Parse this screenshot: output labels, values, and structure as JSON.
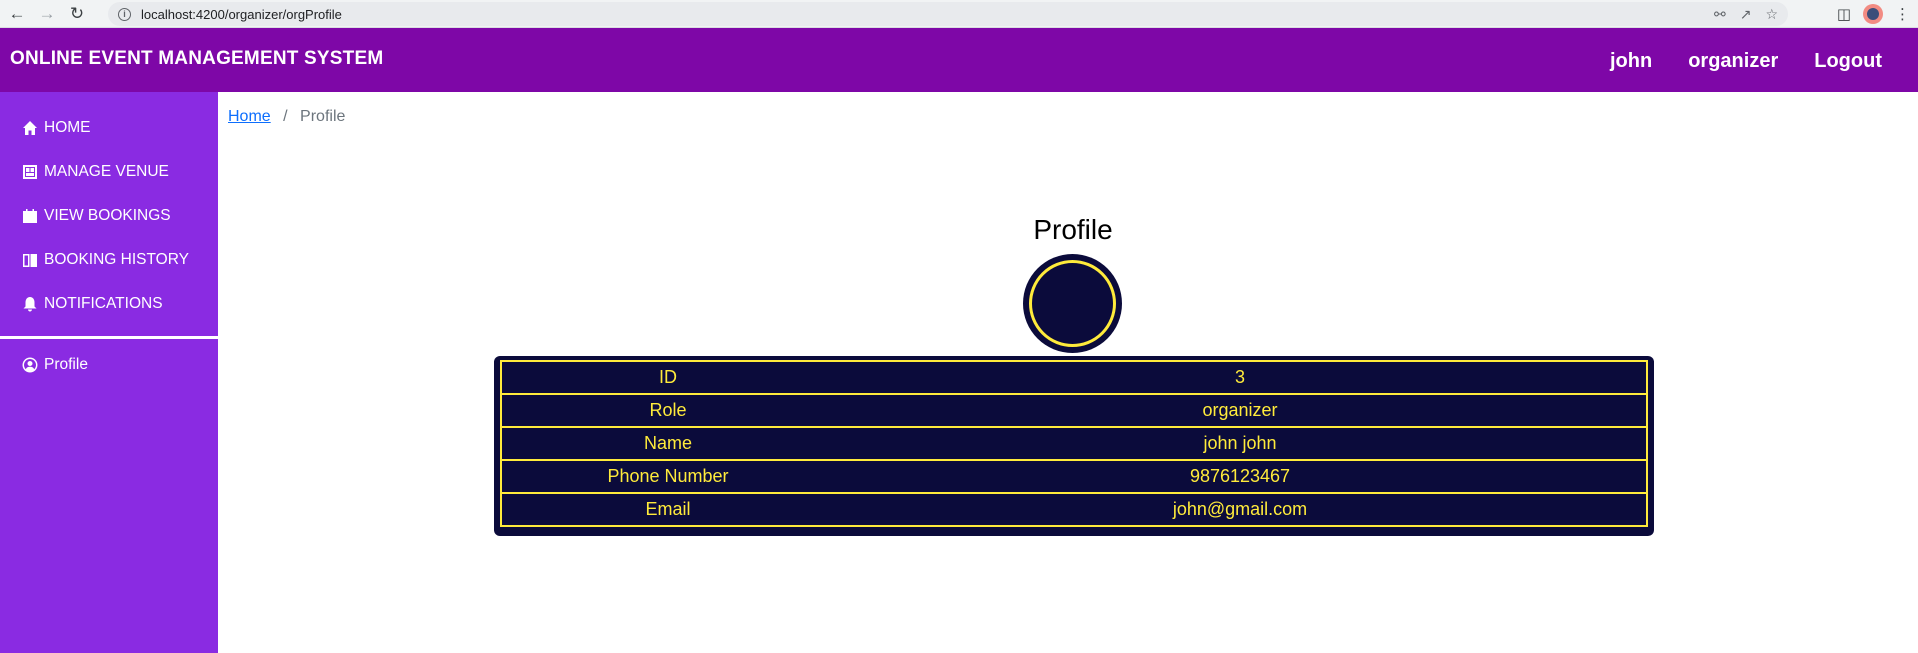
{
  "browser": {
    "url": "localhost:4200/organizer/orgProfile"
  },
  "header": {
    "title": "ONLINE EVENT MANAGEMENT SYSTEM",
    "nav": [
      "john",
      "organizer",
      "Logout"
    ]
  },
  "sidebar": {
    "items": [
      {
        "label": "HOME",
        "icon": "home-icon"
      },
      {
        "label": "MANAGE VENUE",
        "icon": "venue-icon"
      },
      {
        "label": "VIEW BOOKINGS",
        "icon": "calendar-icon"
      },
      {
        "label": "BOOKING HISTORY",
        "icon": "book-icon"
      },
      {
        "label": "NOTIFICATIONS",
        "icon": "bell-icon"
      }
    ],
    "profile": {
      "label": "Profile",
      "icon": "user-circle-icon"
    }
  },
  "breadcrumb": {
    "home": "Home",
    "separator": "/",
    "current": "Profile"
  },
  "profile": {
    "title": "Profile",
    "rows": [
      {
        "key": "ID",
        "value": "3"
      },
      {
        "key": "Role",
        "value": "organizer"
      },
      {
        "key": "Name",
        "value": "john john"
      },
      {
        "key": "Phone Number",
        "value": "9876123467"
      },
      {
        "key": "Email",
        "value": "john@gmail.com"
      }
    ]
  },
  "colors": {
    "header_bg": "#7e07a7",
    "sidebar_bg": "#8a2be2",
    "card_bg": "#0b0b3b",
    "card_text": "#ffeb3b"
  }
}
